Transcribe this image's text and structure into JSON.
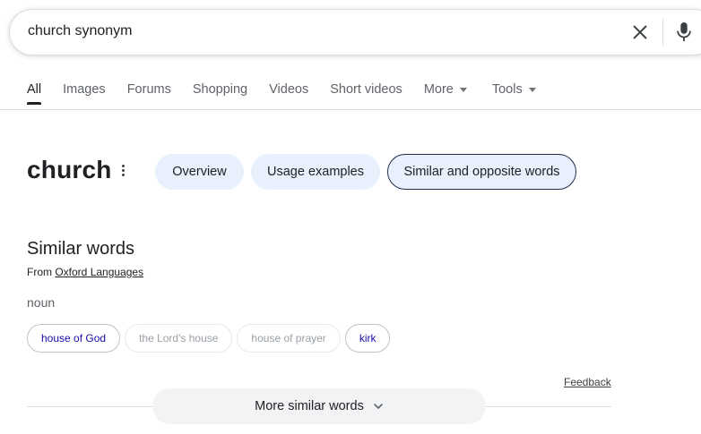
{
  "search": {
    "query": "church synonym"
  },
  "tabs": [
    {
      "label": "All"
    },
    {
      "label": "Images"
    },
    {
      "label": "Forums"
    },
    {
      "label": "Shopping"
    },
    {
      "label": "Videos"
    },
    {
      "label": "Short videos"
    },
    {
      "label": "More"
    },
    {
      "label": "Tools"
    }
  ],
  "dictionary": {
    "word": "church",
    "chips": {
      "overview": "Overview",
      "usage": "Usage examples",
      "similar": "Similar and opposite words"
    }
  },
  "similar": {
    "title": "Similar words",
    "from_prefix": "From ",
    "source": "Oxford Languages",
    "pos": "noun",
    "words": [
      {
        "label": "house of God"
      },
      {
        "label": "the Lord's house"
      },
      {
        "label": "house of prayer"
      },
      {
        "label": "kirk"
      }
    ],
    "feedback": "Feedback",
    "more_button": "More similar words"
  },
  "colors": {
    "link": "#1a0dab",
    "chip_active_bg": "#e8f0fe",
    "muted": "#9aa0a6"
  }
}
